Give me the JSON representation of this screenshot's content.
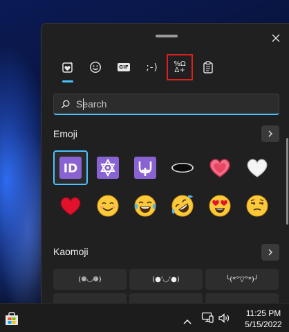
{
  "tabs": [
    {
      "name": "favorites",
      "icon": "heart-sparkle-icon"
    },
    {
      "name": "emoji",
      "icon": "smiley-icon"
    },
    {
      "name": "gif",
      "icon": "gif-icon",
      "label": "GIF"
    },
    {
      "name": "kaomoji",
      "icon": "kaomoji-icon",
      "label": ";-)"
    },
    {
      "name": "symbols",
      "icon": "symbols-icon",
      "label_top": "%Ω",
      "label_bottom": "Δ+"
    },
    {
      "name": "clipboard",
      "icon": "clipboard-icon"
    }
  ],
  "accent_color": "#4cc2ff",
  "highlight_color": "#e0201e",
  "search": {
    "placeholder": "Search"
  },
  "emoji_section": {
    "title": "Emoji",
    "items": [
      "🆔",
      "🔯",
      "⛎",
      "🕳️",
      "💗",
      "🤍",
      "❤️",
      "😊",
      "😂",
      "🤣",
      "😍",
      "😒"
    ]
  },
  "kaomoji_section": {
    "title": "Kaomoji",
    "items": [
      "(❁◡❁)",
      "(●'◡'●)",
      "╰(*°▽°*)╯"
    ]
  },
  "taskbar": {
    "time": "11:25 PM",
    "date": "5/15/2022"
  }
}
